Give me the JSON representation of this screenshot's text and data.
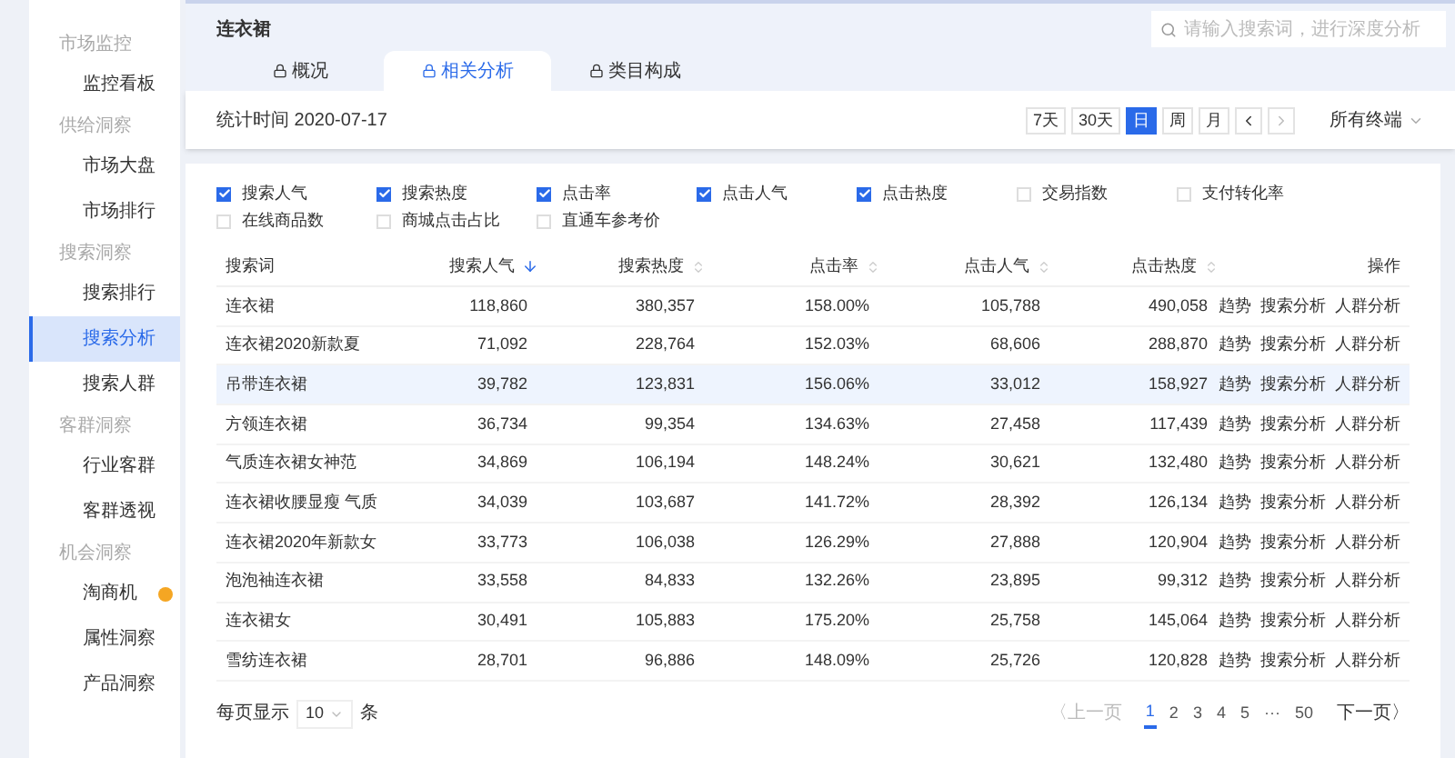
{
  "sidebar": {
    "groups": [
      {
        "label": "市场监控",
        "items": [
          {
            "label": "监控看板",
            "selected": false,
            "badge": false
          }
        ]
      },
      {
        "label": "供给洞察",
        "items": [
          {
            "label": "市场大盘",
            "selected": false,
            "badge": false
          },
          {
            "label": "市场排行",
            "selected": false,
            "badge": false
          }
        ]
      },
      {
        "label": "搜索洞察",
        "items": [
          {
            "label": "搜索排行",
            "selected": false,
            "badge": false
          },
          {
            "label": "搜索分析",
            "selected": true,
            "badge": false
          },
          {
            "label": "搜索人群",
            "selected": false,
            "badge": false
          }
        ]
      },
      {
        "label": "客群洞察",
        "items": [
          {
            "label": "行业客群",
            "selected": false,
            "badge": false
          },
          {
            "label": "客群透视",
            "selected": false,
            "badge": false
          }
        ]
      },
      {
        "label": "机会洞察",
        "items": [
          {
            "label": "淘商机",
            "selected": false,
            "badge": true
          },
          {
            "label": "属性洞察",
            "selected": false,
            "badge": false
          },
          {
            "label": "产品洞察",
            "selected": false,
            "badge": false
          }
        ]
      }
    ]
  },
  "header": {
    "title": "连衣裙",
    "search": {
      "placeholder": "请输入搜索词，进行深度分析"
    }
  },
  "tabs": [
    {
      "label": "概况",
      "selected": false
    },
    {
      "label": "相关分析",
      "selected": true
    },
    {
      "label": "类目构成",
      "selected": false
    }
  ],
  "stat_time": "统计时间 2020-07-17",
  "periods": [
    {
      "label": "7天",
      "selected": false
    },
    {
      "label": "30天",
      "selected": false
    },
    {
      "label": "日",
      "selected": true
    },
    {
      "label": "周",
      "selected": false
    },
    {
      "label": "月",
      "selected": false
    }
  ],
  "terminal": "所有终端",
  "metrics": [
    {
      "label": "搜索人气",
      "checked": true
    },
    {
      "label": "搜索热度",
      "checked": true
    },
    {
      "label": "点击率",
      "checked": true
    },
    {
      "label": "点击人气",
      "checked": true
    },
    {
      "label": "点击热度",
      "checked": true
    },
    {
      "label": "交易指数",
      "checked": false
    },
    {
      "label": "支付转化率",
      "checked": false
    },
    {
      "label": "在线商品数",
      "checked": false
    },
    {
      "label": "商城点击占比",
      "checked": false
    },
    {
      "label": "直通车参考价",
      "checked": false
    }
  ],
  "table": {
    "columns": [
      {
        "label": "搜索词"
      },
      {
        "label": "搜索人气",
        "sorted": true
      },
      {
        "label": "搜索热度",
        "sorted": false
      },
      {
        "label": "点击率",
        "sorted": false
      },
      {
        "label": "点击人气",
        "sorted": false
      },
      {
        "label": "点击热度",
        "sorted": false
      },
      {
        "label": "操作"
      }
    ],
    "rows": [
      {
        "cells": [
          "连衣裙",
          "118,860",
          "380,357",
          "158.00%",
          "105,788",
          "490,058"
        ],
        "actions": [
          "趋势",
          "搜索分析",
          "人群分析"
        ],
        "highlighted": false
      },
      {
        "cells": [
          "连衣裙2020新款夏",
          "71,092",
          "228,764",
          "152.03%",
          "68,606",
          "288,870"
        ],
        "actions": [
          "趋势",
          "搜索分析",
          "人群分析"
        ],
        "highlighted": false
      },
      {
        "cells": [
          "吊带连衣裙",
          "39,782",
          "123,831",
          "156.06%",
          "33,012",
          "158,927"
        ],
        "actions": [
          "趋势",
          "搜索分析",
          "人群分析"
        ],
        "highlighted": true
      },
      {
        "cells": [
          "方领连衣裙",
          "36,734",
          "99,354",
          "134.63%",
          "27,458",
          "117,439"
        ],
        "actions": [
          "趋势",
          "搜索分析",
          "人群分析"
        ],
        "highlighted": false
      },
      {
        "cells": [
          "气质连衣裙女神范",
          "34,869",
          "106,194",
          "148.24%",
          "30,621",
          "132,480"
        ],
        "actions": [
          "趋势",
          "搜索分析",
          "人群分析"
        ],
        "highlighted": false
      },
      {
        "cells": [
          "连衣裙收腰显瘦 气质",
          "34,039",
          "103,687",
          "141.72%",
          "28,392",
          "126,134"
        ],
        "actions": [
          "趋势",
          "搜索分析",
          "人群分析"
        ],
        "highlighted": false
      },
      {
        "cells": [
          "连衣裙2020年新款女",
          "33,773",
          "106,038",
          "126.29%",
          "27,888",
          "120,904"
        ],
        "actions": [
          "趋势",
          "搜索分析",
          "人群分析"
        ],
        "highlighted": false
      },
      {
        "cells": [
          "泡泡袖连衣裙",
          "33,558",
          "84,833",
          "132.26%",
          "23,895",
          "99,312"
        ],
        "actions": [
          "趋势",
          "搜索分析",
          "人群分析"
        ],
        "highlighted": false
      },
      {
        "cells": [
          "连衣裙女",
          "30,491",
          "105,883",
          "175.20%",
          "25,758",
          "145,064"
        ],
        "actions": [
          "趋势",
          "搜索分析",
          "人群分析"
        ],
        "highlighted": false
      },
      {
        "cells": [
          "雪纺连衣裙",
          "28,701",
          "96,886",
          "148.09%",
          "25,726",
          "120,828"
        ],
        "actions": [
          "趋势",
          "搜索分析",
          "人群分析"
        ],
        "highlighted": false
      }
    ]
  },
  "page_size": {
    "label": "每页显示",
    "value": "10",
    "unit": "条"
  },
  "pagination": {
    "prev": "〈上一页",
    "pages": [
      {
        "label": "1",
        "selected": true
      },
      {
        "label": "2",
        "selected": false
      },
      {
        "label": "3",
        "selected": false
      },
      {
        "label": "4",
        "selected": false
      },
      {
        "label": "5",
        "selected": false
      },
      {
        "label": "···",
        "selected": false
      },
      {
        "label": "50",
        "selected": false
      }
    ],
    "next": "下一页〉"
  }
}
